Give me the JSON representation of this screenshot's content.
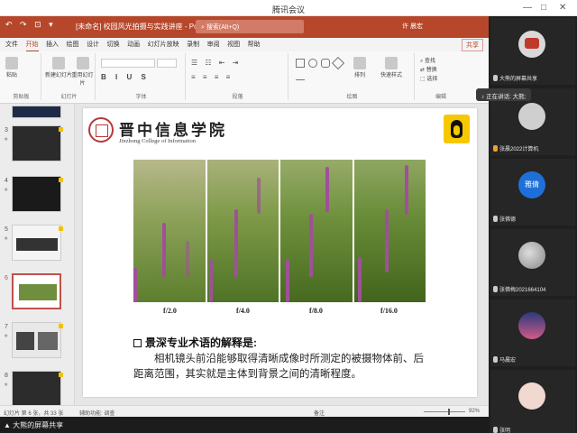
{
  "meeting": {
    "window_title": "腾讯会议",
    "talking": "正在讲话: 大熊;",
    "share_label": "大熊的屏幕共享",
    "participants": [
      {
        "name": "大熊的屏幕共享"
      },
      {
        "name": "张晨2022计算机"
      },
      {
        "name": "张佛德",
        "avatar_text": "雅倩"
      },
      {
        "name": "张佛梅2021664104"
      },
      {
        "name": "马晨宏"
      },
      {
        "name": "张明"
      }
    ]
  },
  "ppt": {
    "title": "[未命名] 校园风光拍摄与实践讲座 - PowerPoint",
    "search": "搜索(Alt+Q)",
    "user": "许 晨宏",
    "quick_access": "↶ ↷ ⊡ ▾",
    "tabs": [
      "文件",
      "开始",
      "插入",
      "绘图",
      "设计",
      "切换",
      "动画",
      "幻灯片放映",
      "录制",
      "审阅",
      "视图",
      "帮助"
    ],
    "active_tab": "开始",
    "share_button": "共享",
    "ribbon_groups": [
      "剪贴板",
      "幻灯片",
      "字体",
      "段落",
      "绘图",
      "编辑"
    ],
    "ribbon_buttons": {
      "paste": "粘贴",
      "new_slide": "新建幻灯片",
      "reuse": "重用幻灯片",
      "arrange": "排列",
      "quick_style": "快速样式",
      "find": "查找",
      "replace": "替换",
      "select": "选择"
    },
    "thumbnails": [
      {
        "num": "3"
      },
      {
        "num": "4"
      },
      {
        "num": "5"
      },
      {
        "num": "6",
        "selected": true
      },
      {
        "num": "7"
      },
      {
        "num": "8"
      }
    ],
    "status_left": "幻灯片 第 6 张，共 33 张",
    "status_mid": "辅助功能: 调查",
    "notes": "备注",
    "zoom": "92%"
  },
  "slide": {
    "school_cn": "晋中信息学院",
    "school_en": "Jinzhong College of Information",
    "photo_labels": [
      "f/2.0",
      "f/4.0",
      "f/8.0",
      "f/16.0"
    ],
    "heading": "景深专业术语的解释是:",
    "body": "相机镜头前沿能够取得清晰成像时所测定的被摄物体前、后距离范围，其实就是主体到背景之间的清晰程度。"
  }
}
